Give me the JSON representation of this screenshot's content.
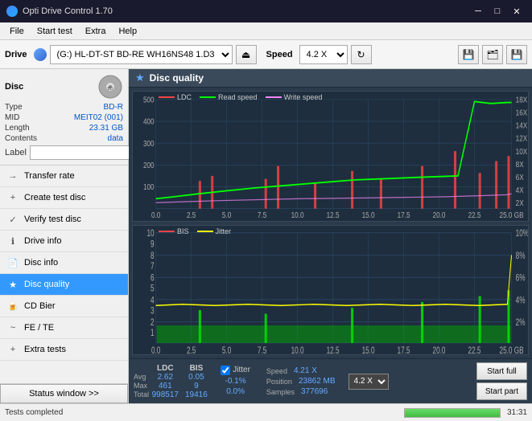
{
  "titleBar": {
    "title": "Opti Drive Control 1.70",
    "controls": [
      "minimize",
      "maximize",
      "close"
    ]
  },
  "menuBar": {
    "items": [
      "File",
      "Start test",
      "Extra",
      "Help"
    ]
  },
  "toolbar": {
    "driveLabel": "Drive",
    "driveValue": "(G:) HL-DT-ST BD-RE  WH16NS48 1.D3",
    "speedLabel": "Speed",
    "speedValue": "4.2 X"
  },
  "disc": {
    "title": "Disc",
    "typeLabel": "Type",
    "typeValue": "BD-R",
    "midLabel": "MID",
    "midValue": "MEIT02 (001)",
    "lengthLabel": "Length",
    "lengthValue": "23.31 GB",
    "contentsLabel": "Contents",
    "contentsValue": "data",
    "labelLabel": "Label",
    "labelValue": ""
  },
  "navItems": [
    {
      "id": "transfer-rate",
      "label": "Transfer rate",
      "icon": "→"
    },
    {
      "id": "create-test-disc",
      "label": "Create test disc",
      "icon": "+"
    },
    {
      "id": "verify-test-disc",
      "label": "Verify test disc",
      "icon": "✓"
    },
    {
      "id": "drive-info",
      "label": "Drive info",
      "icon": "i"
    },
    {
      "id": "disc-info",
      "label": "Disc info",
      "icon": "📄"
    },
    {
      "id": "disc-quality",
      "label": "Disc quality",
      "icon": "★",
      "active": true
    },
    {
      "id": "cd-bier",
      "label": "CD Bier",
      "icon": "🍺"
    },
    {
      "id": "fe-te",
      "label": "FE / TE",
      "icon": "~"
    },
    {
      "id": "extra-tests",
      "label": "Extra tests",
      "icon": "+"
    }
  ],
  "statusBtn": "Status window >>",
  "chart1": {
    "title": "Disc quality",
    "legend": [
      {
        "label": "LDC",
        "color": "#ff4444"
      },
      {
        "label": "Read speed",
        "color": "#00ff00"
      },
      {
        "label": "Write speed",
        "color": "#ff88ff"
      }
    ],
    "yAxisRight": [
      "18X",
      "16X",
      "14X",
      "12X",
      "10X",
      "8X",
      "6X",
      "4X",
      "2X"
    ],
    "yAxisLeft": [
      "500",
      "400",
      "300",
      "200",
      "100"
    ],
    "xAxis": [
      "0.0",
      "2.5",
      "5.0",
      "7.5",
      "10.0",
      "12.5",
      "15.0",
      "17.5",
      "20.0",
      "22.5",
      "25.0 GB"
    ]
  },
  "chart2": {
    "legend": [
      {
        "label": "BIS",
        "color": "#ff4444"
      },
      {
        "label": "Jitter",
        "color": "#ffff00"
      }
    ],
    "yAxisRight": [
      "10%",
      "8%",
      "6%",
      "4%",
      "2%"
    ],
    "yAxisLeft": [
      "10",
      "9",
      "8",
      "7",
      "6",
      "5",
      "4",
      "3",
      "2",
      "1"
    ],
    "xAxis": [
      "0.0",
      "2.5",
      "5.0",
      "7.5",
      "10.0",
      "12.5",
      "15.0",
      "17.5",
      "20.0",
      "22.5",
      "25.0 GB"
    ]
  },
  "stats": {
    "columns": [
      {
        "header": "LDC",
        "avg": "2.62",
        "max": "461",
        "total": "998517"
      },
      {
        "header": "BIS",
        "avg": "0.05",
        "max": "9",
        "total": "19416"
      },
      {
        "header": "Jitter",
        "avg": "-0.1%",
        "max": "0.0%",
        "total": ""
      },
      {
        "speedHeader": "Speed",
        "speedVal": "4.21 X"
      },
      {
        "posLabel": "Position",
        "posVal": "23862 MB"
      },
      {
        "samplesLabel": "Samples",
        "samplesVal": "377696"
      }
    ],
    "jitterChecked": true,
    "jitterLabel": "Jitter",
    "speedDropdown": "4.2 X",
    "avgLabel": "Avg",
    "maxLabel": "Max",
    "totalLabel": "Total"
  },
  "buttons": {
    "startFull": "Start full",
    "startPart": "Start part"
  },
  "statusBar": {
    "text": "Tests completed",
    "progress": 100,
    "time": "31:31"
  }
}
